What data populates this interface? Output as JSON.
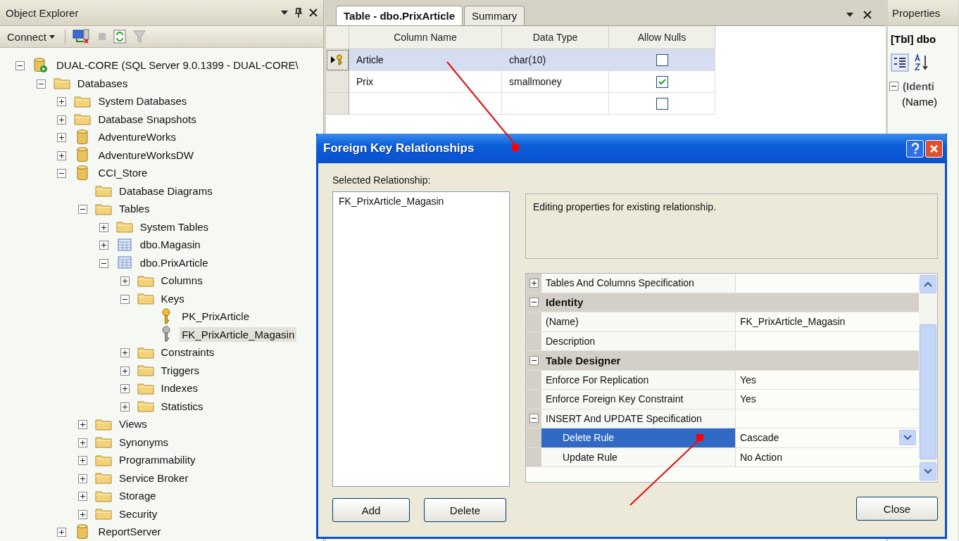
{
  "object_explorer": {
    "title": "Object Explorer",
    "connect": "Connect",
    "tree": [
      {
        "label": "DUAL-CORE (SQL Server 9.0.1399 - DUAL-CORE\\",
        "kind": "server",
        "expanded": true,
        "selected": false,
        "children": [
          {
            "label": "Databases",
            "kind": "folder",
            "expanded": true,
            "selected": false,
            "children": [
              {
                "label": "System Databases",
                "kind": "folder",
                "expanded": false,
                "selected": false
              },
              {
                "label": "Database Snapshots",
                "kind": "folder",
                "expanded": false,
                "selected": false
              },
              {
                "label": "AdventureWorks",
                "kind": "database",
                "expanded": false,
                "selected": false
              },
              {
                "label": "AdventureWorksDW",
                "kind": "database",
                "expanded": false,
                "selected": false
              },
              {
                "label": "CCI_Store",
                "kind": "database",
                "expanded": true,
                "selected": false,
                "children": [
                  {
                    "label": "Database Diagrams",
                    "kind": "folder",
                    "selected": false
                  },
                  {
                    "label": "Tables",
                    "kind": "folder",
                    "expanded": true,
                    "selected": false,
                    "children": [
                      {
                        "label": "System Tables",
                        "kind": "folder",
                        "expanded": false,
                        "selected": false
                      },
                      {
                        "label": "dbo.Magasin",
                        "kind": "table",
                        "expanded": false,
                        "selected": false
                      },
                      {
                        "label": "dbo.PrixArticle",
                        "kind": "table",
                        "expanded": true,
                        "selected": false,
                        "children": [
                          {
                            "label": "Columns",
                            "kind": "folder",
                            "expanded": false,
                            "selected": false
                          },
                          {
                            "label": "Keys",
                            "kind": "folder",
                            "expanded": true,
                            "selected": false,
                            "children": [
                              {
                                "label": "PK_PrixArticle",
                                "kind": "primary-key",
                                "selected": false
                              },
                              {
                                "label": "FK_PrixArticle_Magasin",
                                "kind": "foreign-key",
                                "selected": true
                              }
                            ]
                          },
                          {
                            "label": "Constraints",
                            "kind": "folder",
                            "expanded": false,
                            "selected": false
                          },
                          {
                            "label": "Triggers",
                            "kind": "folder",
                            "expanded": false,
                            "selected": false
                          },
                          {
                            "label": "Indexes",
                            "kind": "folder",
                            "expanded": false,
                            "selected": false
                          },
                          {
                            "label": "Statistics",
                            "kind": "folder",
                            "expanded": false,
                            "selected": false
                          }
                        ]
                      }
                    ]
                  },
                  {
                    "label": "Views",
                    "kind": "folder",
                    "expanded": false,
                    "selected": false
                  },
                  {
                    "label": "Synonyms",
                    "kind": "folder",
                    "expanded": false,
                    "selected": false
                  },
                  {
                    "label": "Programmability",
                    "kind": "folder",
                    "expanded": false,
                    "selected": false
                  },
                  {
                    "label": "Service Broker",
                    "kind": "folder",
                    "expanded": false,
                    "selected": false
                  },
                  {
                    "label": "Storage",
                    "kind": "folder",
                    "expanded": false,
                    "selected": false
                  },
                  {
                    "label": "Security",
                    "kind": "folder",
                    "expanded": false,
                    "selected": false
                  }
                ]
              },
              {
                "label": "ReportServer",
                "kind": "database",
                "expanded": false,
                "selected": false
              }
            ]
          }
        ]
      }
    ]
  },
  "document": {
    "tabs": [
      {
        "label": "Table - dbo.PrixArticle",
        "selected": true
      },
      {
        "label": "Summary",
        "selected": false
      }
    ],
    "columns": [
      "Column Name",
      "Data Type",
      "Allow Nulls"
    ],
    "rows": [
      {
        "name": "Article",
        "type": "char(10)",
        "allow_nulls": false,
        "primary_key": true,
        "selected": true
      },
      {
        "name": "Prix",
        "type": "smallmoney",
        "allow_nulls": true,
        "primary_key": false,
        "selected": false
      },
      {
        "allow_nulls": false,
        "primary_key": false,
        "selected": false
      }
    ]
  },
  "properties": {
    "title": "Properties",
    "object": "[Tbl] dbo",
    "category": "(Identi",
    "row": "(Name)"
  },
  "dialog": {
    "title": "Foreign Key Relationships",
    "list_label": "Selected Relationship:",
    "relationships": [
      {
        "label": "FK_PrixArticle_Magasin",
        "selected": false
      }
    ],
    "description": "Editing properties for existing relationship.",
    "grid": [
      {
        "kind": "group",
        "label": "Tables And Columns Specification",
        "expanded": false,
        "selected": false
      },
      {
        "kind": "category",
        "label": "Identity",
        "expanded": true,
        "children": [
          {
            "kind": "property",
            "label": "(Name)",
            "value": "FK_PrixArticle_Magasin",
            "selected": false
          },
          {
            "kind": "property",
            "label": "Description",
            "selected": false
          }
        ]
      },
      {
        "kind": "category",
        "label": "Table Designer",
        "expanded": true,
        "children": [
          {
            "kind": "property",
            "label": "Enforce For Replication",
            "value": "Yes",
            "selected": false
          },
          {
            "kind": "property",
            "label": "Enforce Foreign Key Constraint",
            "value": "Yes",
            "selected": false
          },
          {
            "kind": "group",
            "label": "INSERT And UPDATE Specification",
            "expanded": true,
            "selected": false,
            "children": [
              {
                "kind": "dropdown",
                "label": "Delete Rule",
                "value": "Cascade",
                "selected": true
              },
              {
                "kind": "property",
                "label": "Update Rule",
                "value": "No Action",
                "selected": false
              }
            ]
          }
        ]
      }
    ],
    "buttons": {
      "add": "Add",
      "delete": "Delete",
      "close": "Close"
    }
  }
}
